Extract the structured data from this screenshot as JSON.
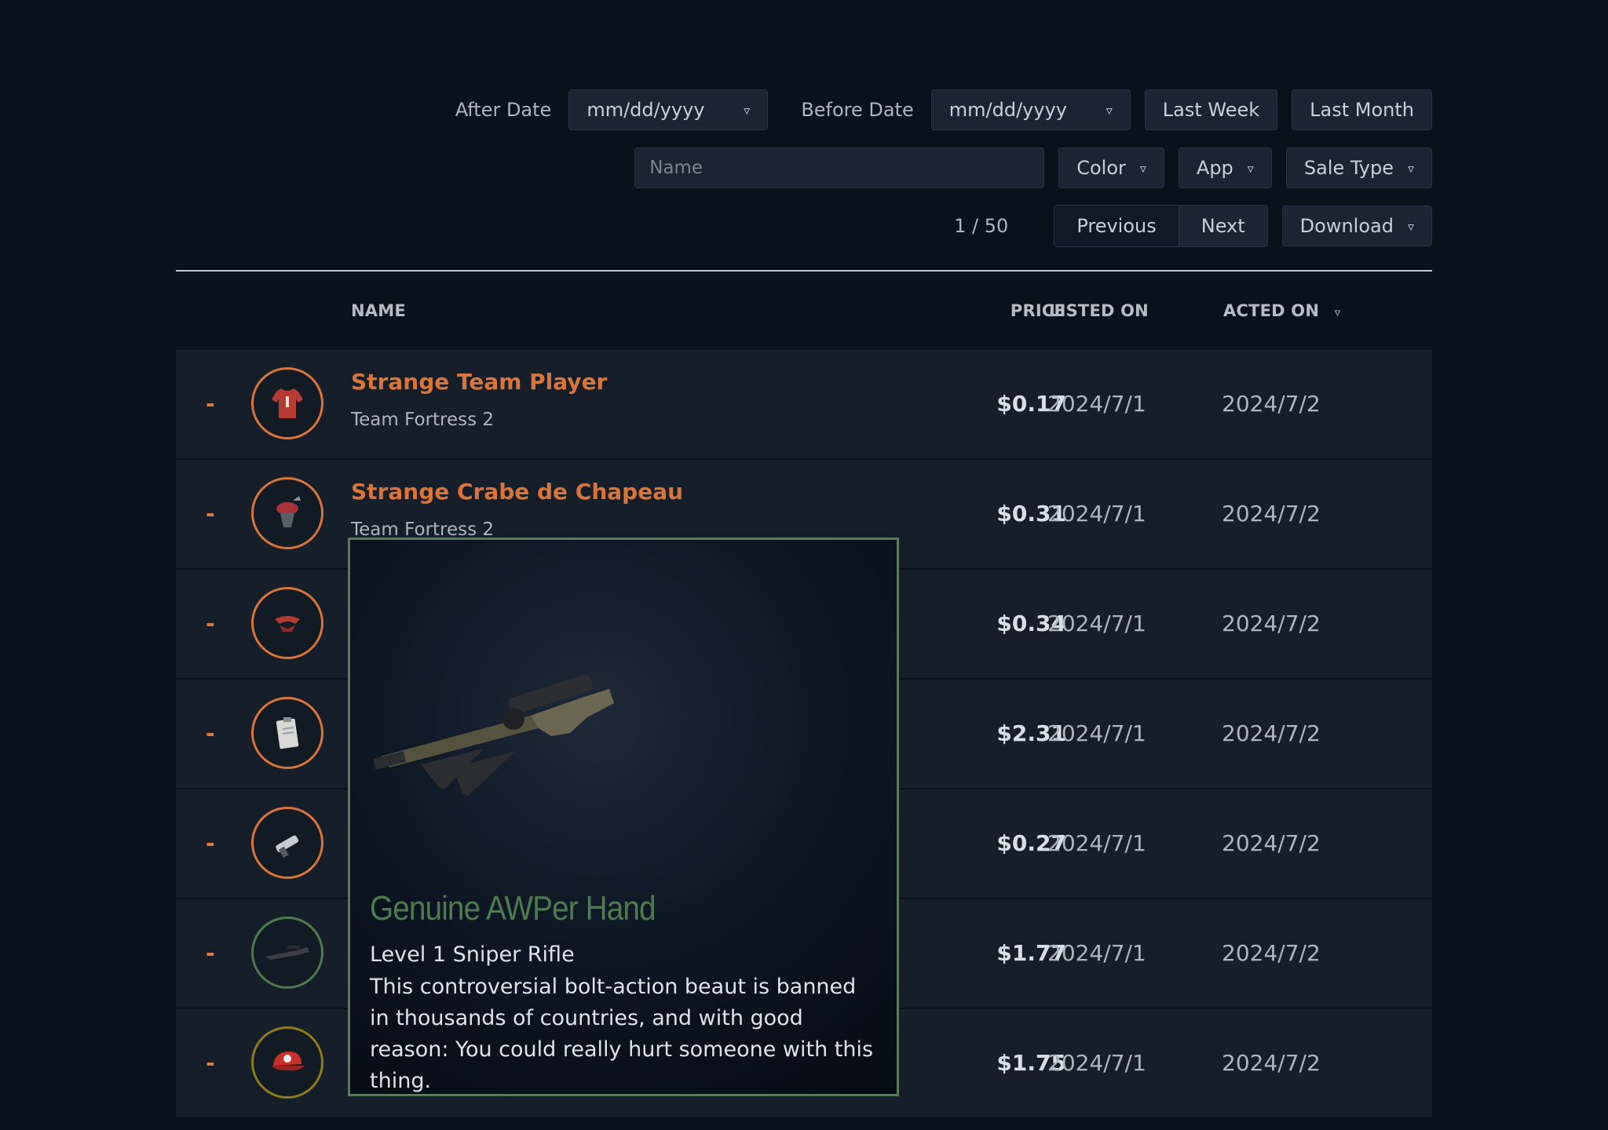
{
  "filters": {
    "after_label": "After Date",
    "after_placeholder": "mm/dd/yyyy",
    "before_label": "Before Date",
    "before_placeholder": "mm/dd/yyyy",
    "last_week": "Last Week",
    "last_month": "Last Month",
    "name_placeholder": "Name",
    "color": "Color",
    "app": "App",
    "sale_type": "Sale Type",
    "caret": "▿"
  },
  "pagination": {
    "page_info": "1 / 50",
    "previous": "Previous",
    "next": "Next",
    "download": "Download"
  },
  "table": {
    "headers": {
      "name": "NAME",
      "price": "PRICE",
      "listed_on": "LISTED ON",
      "acted_on": "ACTED ON",
      "sort_caret": "▿"
    },
    "rows": [
      {
        "marker": "-",
        "name": "Strange Team Player",
        "app": "Team Fortress 2",
        "price": "$0.17",
        "listed": "2024/7/1",
        "acted": "2024/7/2",
        "icon": "red-shirt-icon",
        "ring_color": "#d9743a"
      },
      {
        "marker": "-",
        "name": "Strange Crabe de Chapeau",
        "app": "Team Fortress 2",
        "price": "$0.31",
        "listed": "2024/7/1",
        "acted": "2024/7/2",
        "icon": "crab-hat-icon",
        "ring_color": "#d9743a"
      },
      {
        "marker": "-",
        "name": "",
        "app": "",
        "price": "$0.34",
        "listed": "2024/7/1",
        "acted": "2024/7/2",
        "icon": "red-ribbon-icon",
        "ring_color": "#d9743a"
      },
      {
        "marker": "-",
        "name": "",
        "app": "",
        "price": "$2.31",
        "listed": "2024/7/1",
        "acted": "2024/7/2",
        "icon": "clipboard-icon",
        "ring_color": "#d9743a"
      },
      {
        "marker": "-",
        "name": "",
        "app": "",
        "price": "$0.27",
        "listed": "2024/7/1",
        "acted": "2024/7/2",
        "icon": "syringe-gun-icon",
        "ring_color": "#d9743a"
      },
      {
        "marker": "-",
        "name": "",
        "app": "",
        "price": "$1.77",
        "listed": "2024/7/1",
        "acted": "2024/7/2",
        "icon": "sniper-rifle-icon",
        "ring_color": "#4f7a50"
      },
      {
        "marker": "-",
        "name": "",
        "app": "",
        "price": "$1.75",
        "listed": "2024/7/1",
        "acted": "2024/7/2",
        "icon": "red-cap-icon",
        "ring_color": "#8f7a1c"
      }
    ]
  },
  "tooltip": {
    "title": "Genuine AWPer Hand",
    "level": "Level 1 Sniper Rifle",
    "description": "This controversial bolt-action beaut is banned in thousands of countries, and with good reason: You could really hurt someone with this thing.",
    "title_color": "#4f7a50",
    "icon": "sniper-rifle-icon"
  }
}
